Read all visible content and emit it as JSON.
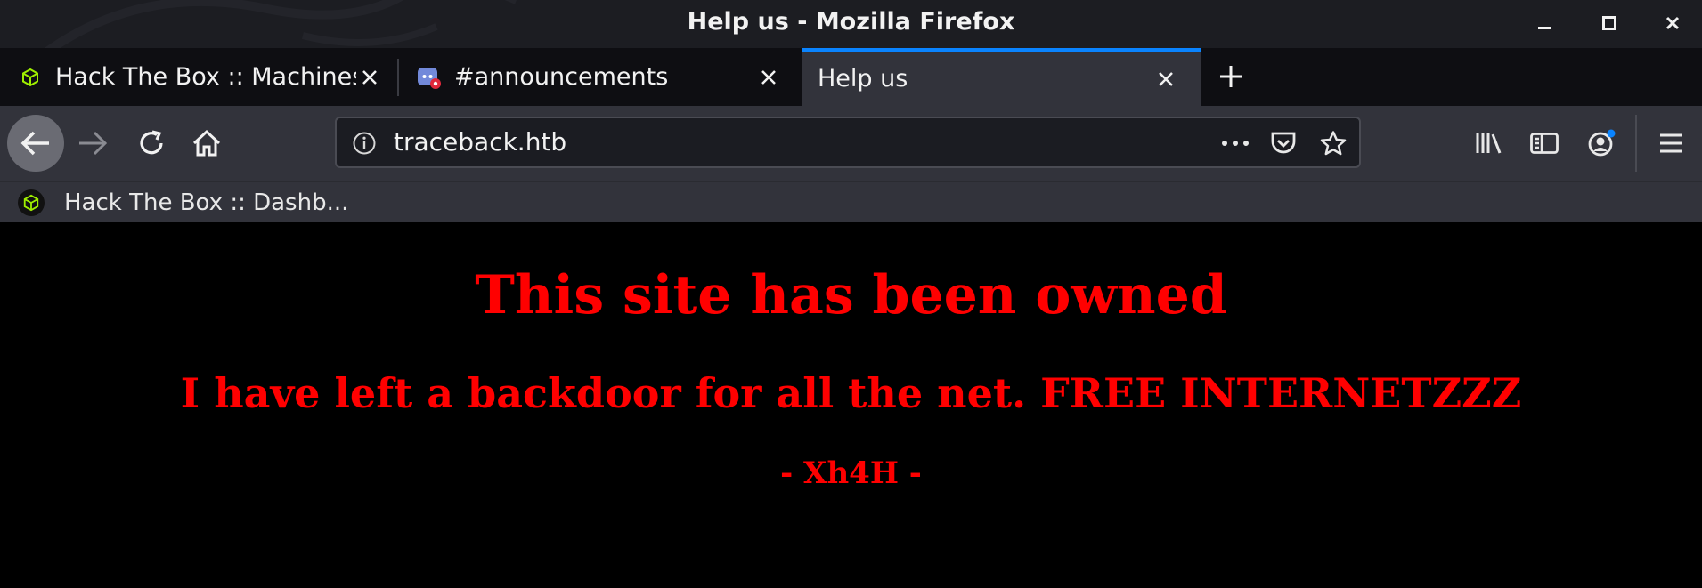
{
  "window": {
    "title": "Help us - Mozilla Firefox"
  },
  "tabs": [
    {
      "label": "Hack The Box :: Machines",
      "favicon": "htb-cube-icon",
      "active": false
    },
    {
      "label": "#announcements",
      "favicon": "discord-icon",
      "active": false
    },
    {
      "label": "Help us",
      "favicon": "",
      "active": true
    }
  ],
  "navbar": {
    "url": "traceback.htb"
  },
  "bookmarks": [
    {
      "label": "Hack The Box :: Dashb...",
      "favicon": "htb-cube-icon"
    }
  ],
  "page": {
    "heading": "This site has been owned",
    "subheading": "I have left a backdoor for all the net. FREE INTERNETZZZ",
    "signature": "- Xh4H -"
  },
  "colors": {
    "page_background": "#000000",
    "page_text": "#ff0000",
    "active_tab_accent": "#0a84ff",
    "htb_green": "#9fef00"
  }
}
